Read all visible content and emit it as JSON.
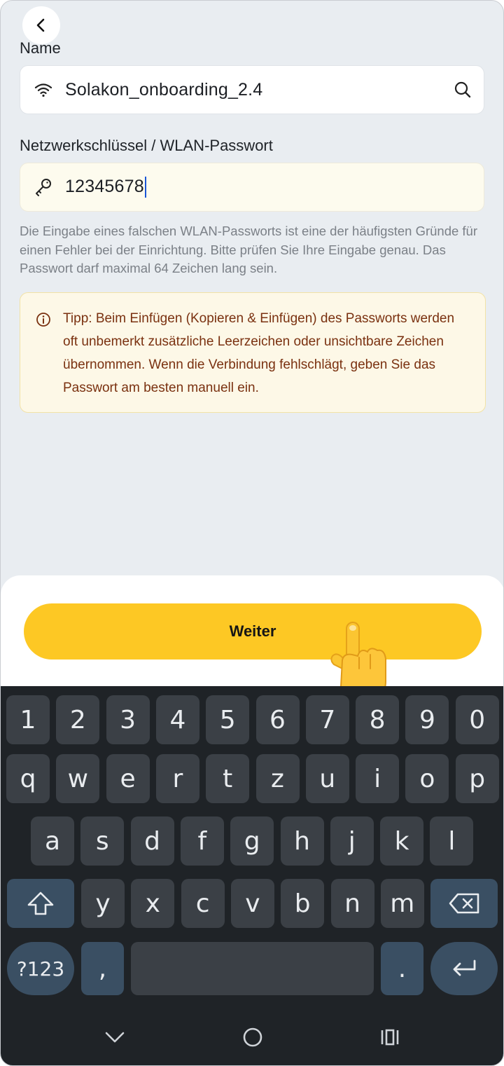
{
  "header": {
    "back_icon": "chevron-left-icon"
  },
  "form": {
    "name_label": "Name",
    "name_value": "Solakon_onboarding_2.4",
    "name_leading_icon": "wifi-icon",
    "name_trailing_icon": "search-icon",
    "password_label": "Netzwerkschlüssel / WLAN-Passwort",
    "password_value": "12345678",
    "password_leading_icon": "key-icon",
    "helper_text": "Die Eingabe eines falschen WLAN-Passworts ist eine der häufigsten Gründe für einen Fehler bei der Einrichtung. Bitte prüfen Sie Ihre Eingabe genau. Das Passwort darf maximal 64 Zeichen lang sein."
  },
  "tip": {
    "icon": "info-icon",
    "text": "Tipp: Beim Einfügen (Kopieren & Einfügen) des Passworts werden oft unbemerkt zusätzliche Leerzeichen oder unsichtbare Zeichen übernommen. Wenn die Verbindung fehlschlägt, geben Sie das Passwort am besten manuell ein."
  },
  "cta": {
    "label": "Weiter"
  },
  "keyboard": {
    "row1": [
      "1",
      "2",
      "3",
      "4",
      "5",
      "6",
      "7",
      "8",
      "9",
      "0"
    ],
    "row2": [
      "q",
      "w",
      "e",
      "r",
      "t",
      "z",
      "u",
      "i",
      "o",
      "p"
    ],
    "row3": [
      "a",
      "s",
      "d",
      "f",
      "g",
      "h",
      "j",
      "k",
      "l"
    ],
    "row4": [
      "y",
      "x",
      "c",
      "v",
      "b",
      "n",
      "m"
    ],
    "symbols_label": "?123",
    "comma": ",",
    "period": ".",
    "shift_icon": "shift-icon",
    "backspace_icon": "backspace-icon",
    "enter_icon": "enter-icon"
  },
  "navigation": {
    "back_icon": "nav-back-icon",
    "home_icon": "nav-home-icon",
    "recents_icon": "nav-recents-icon"
  },
  "colors": {
    "accent": "#fdc824",
    "tip_text": "#7a3110",
    "tip_background": "#fdf8e7",
    "keyboard_background": "#1f2327"
  }
}
